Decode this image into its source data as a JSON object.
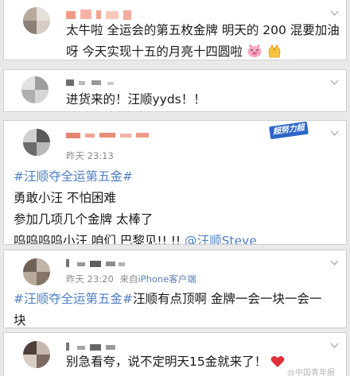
{
  "comments": [
    {
      "text": [
        "太牛啦 全运会的第五枚金牌 明天的 200 混要加油",
        "呀 今天实现十五的月亮十四圆啦"
      ],
      "emoji": [
        "pig-face-icon",
        "raised-hands-icon"
      ]
    },
    {
      "text": "进货来的！汪顺yyds！！"
    },
    {
      "time": "昨天 23:13",
      "badge": "超努力超优秀",
      "topic": "#汪顺夺全运第五金#",
      "lines": [
        "勇敢小汪 不怕困难",
        "参加几项几个金牌 太棒了",
        "呜呜呜呜小汪 咱们 巴黎见!! !!"
      ],
      "mention": "@汪顺Steve"
    },
    {
      "time": "昨天 23:20",
      "from": "来自",
      "client": "iPhone客户端",
      "topic": "#汪顺夺全运第五金#",
      "line1_rest": "汪顺有点顶啊 金牌一会一块一会一",
      "line2": "块"
    },
    {
      "text": "别急看夸，说不定明天15金就来了！",
      "emoji": "red-heart-icon"
    }
  ],
  "watermark": "@中国青年报",
  "colors": {
    "topic_link": "#4f7fc1",
    "badge": "#2d66c8",
    "heart": "#e0303a"
  }
}
